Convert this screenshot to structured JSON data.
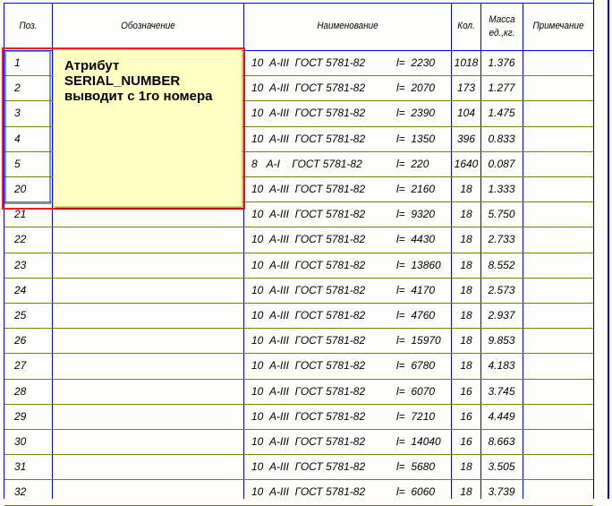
{
  "table": {
    "headers": {
      "pos": "Поз.",
      "designation": "Обозначение",
      "name": "Наименование",
      "qty": "Кол.",
      "mass": "Масса ед.,кг.",
      "note": "Примечание"
    },
    "rows": [
      {
        "pos": "1",
        "name": "10  А-III  ГОСТ 5781-82",
        "len": "l=  2230",
        "qty": "1018",
        "mass": "1.376"
      },
      {
        "pos": "2",
        "name": "10  А-III  ГОСТ 5781-82",
        "len": "l=  2070",
        "qty": "173",
        "mass": "1.277"
      },
      {
        "pos": "3",
        "name": "10  А-III  ГОСТ 5781-82",
        "len": "l=  2390",
        "qty": "104",
        "mass": "1.475"
      },
      {
        "pos": "4",
        "name": "10  А-III  ГОСТ 5781-82",
        "len": "l=  1350",
        "qty": "396",
        "mass": "0.833"
      },
      {
        "pos": "5",
        "name": "8   А-I    ГОСТ 5781-82",
        "len": "l=  220",
        "qty": "1640",
        "mass": "0.087"
      },
      {
        "pos": "20",
        "name": "10  А-III  ГОСТ 5781-82",
        "len": "l=  2160",
        "qty": "18",
        "mass": "1.333"
      },
      {
        "pos": "21",
        "name": "10  А-III  ГОСТ 5781-82",
        "len": "l=  9320",
        "qty": "18",
        "mass": "5.750"
      },
      {
        "pos": "22",
        "name": "10  А-III  ГОСТ 5781-82",
        "len": "l=  4430",
        "qty": "18",
        "mass": "2.733"
      },
      {
        "pos": "23",
        "name": "10  А-III  ГОСТ 5781-82",
        "len": "l=  13860",
        "qty": "18",
        "mass": "8.552"
      },
      {
        "pos": "24",
        "name": "10  А-III  ГОСТ 5781-82",
        "len": "l=  4170",
        "qty": "18",
        "mass": "2.573"
      },
      {
        "pos": "25",
        "name": "10  А-III  ГОСТ 5781-82",
        "len": "l=  4760",
        "qty": "18",
        "mass": "2.937"
      },
      {
        "pos": "26",
        "name": "10  А-III  ГОСТ 5781-82",
        "len": "l=  15970",
        "qty": "18",
        "mass": "9.853"
      },
      {
        "pos": "27",
        "name": "10  А-III  ГОСТ 5781-82",
        "len": "l=  6780",
        "qty": "18",
        "mass": "4.183"
      },
      {
        "pos": "28",
        "name": "10  А-III  ГОСТ 5781-82",
        "len": "l=  6070",
        "qty": "16",
        "mass": "3.745"
      },
      {
        "pos": "29",
        "name": "10  А-III  ГОСТ 5781-82",
        "len": "l=  7210",
        "qty": "16",
        "mass": "4.449"
      },
      {
        "pos": "30",
        "name": "10  А-III  ГОСТ 5781-82",
        "len": "l=  14040",
        "qty": "16",
        "mass": "8.663"
      },
      {
        "pos": "31",
        "name": "10  А-III  ГОСТ 5781-82",
        "len": "l=  5680",
        "qty": "18",
        "mass": "3.505"
      },
      {
        "pos": "32",
        "name": "10  А-III  ГОСТ 5781-82",
        "len": "l=  6060",
        "qty": "18",
        "mass": "3.739"
      }
    ]
  },
  "callout": {
    "text": "Атрибут\nSERIAL_NUMBER\nвыводит с 1го номера"
  }
}
